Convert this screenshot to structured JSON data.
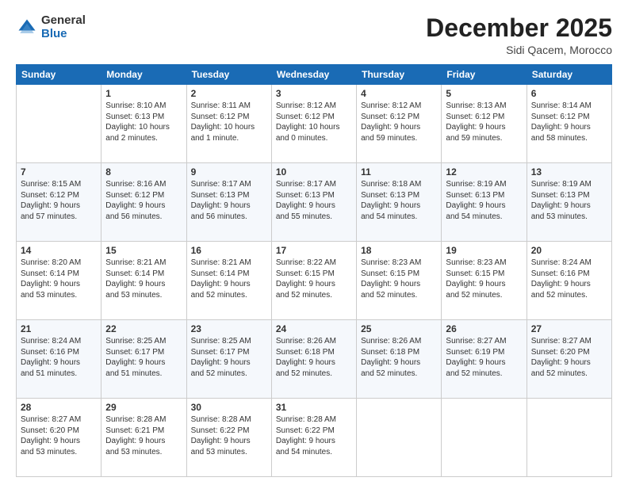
{
  "logo": {
    "general": "General",
    "blue": "Blue"
  },
  "title": "December 2025",
  "subtitle": "Sidi Qacem, Morocco",
  "weekdays": [
    "Sunday",
    "Monday",
    "Tuesday",
    "Wednesday",
    "Thursday",
    "Friday",
    "Saturday"
  ],
  "weeks": [
    [
      {
        "day": "",
        "content": ""
      },
      {
        "day": "1",
        "content": "Sunrise: 8:10 AM\nSunset: 6:13 PM\nDaylight: 10 hours\nand 2 minutes."
      },
      {
        "day": "2",
        "content": "Sunrise: 8:11 AM\nSunset: 6:12 PM\nDaylight: 10 hours\nand 1 minute."
      },
      {
        "day": "3",
        "content": "Sunrise: 8:12 AM\nSunset: 6:12 PM\nDaylight: 10 hours\nand 0 minutes."
      },
      {
        "day": "4",
        "content": "Sunrise: 8:12 AM\nSunset: 6:12 PM\nDaylight: 9 hours\nand 59 minutes."
      },
      {
        "day": "5",
        "content": "Sunrise: 8:13 AM\nSunset: 6:12 PM\nDaylight: 9 hours\nand 59 minutes."
      },
      {
        "day": "6",
        "content": "Sunrise: 8:14 AM\nSunset: 6:12 PM\nDaylight: 9 hours\nand 58 minutes."
      }
    ],
    [
      {
        "day": "7",
        "content": "Sunrise: 8:15 AM\nSunset: 6:12 PM\nDaylight: 9 hours\nand 57 minutes."
      },
      {
        "day": "8",
        "content": "Sunrise: 8:16 AM\nSunset: 6:12 PM\nDaylight: 9 hours\nand 56 minutes."
      },
      {
        "day": "9",
        "content": "Sunrise: 8:17 AM\nSunset: 6:13 PM\nDaylight: 9 hours\nand 56 minutes."
      },
      {
        "day": "10",
        "content": "Sunrise: 8:17 AM\nSunset: 6:13 PM\nDaylight: 9 hours\nand 55 minutes."
      },
      {
        "day": "11",
        "content": "Sunrise: 8:18 AM\nSunset: 6:13 PM\nDaylight: 9 hours\nand 54 minutes."
      },
      {
        "day": "12",
        "content": "Sunrise: 8:19 AM\nSunset: 6:13 PM\nDaylight: 9 hours\nand 54 minutes."
      },
      {
        "day": "13",
        "content": "Sunrise: 8:19 AM\nSunset: 6:13 PM\nDaylight: 9 hours\nand 53 minutes."
      }
    ],
    [
      {
        "day": "14",
        "content": "Sunrise: 8:20 AM\nSunset: 6:14 PM\nDaylight: 9 hours\nand 53 minutes."
      },
      {
        "day": "15",
        "content": "Sunrise: 8:21 AM\nSunset: 6:14 PM\nDaylight: 9 hours\nand 53 minutes."
      },
      {
        "day": "16",
        "content": "Sunrise: 8:21 AM\nSunset: 6:14 PM\nDaylight: 9 hours\nand 52 minutes."
      },
      {
        "day": "17",
        "content": "Sunrise: 8:22 AM\nSunset: 6:15 PM\nDaylight: 9 hours\nand 52 minutes."
      },
      {
        "day": "18",
        "content": "Sunrise: 8:23 AM\nSunset: 6:15 PM\nDaylight: 9 hours\nand 52 minutes."
      },
      {
        "day": "19",
        "content": "Sunrise: 8:23 AM\nSunset: 6:15 PM\nDaylight: 9 hours\nand 52 minutes."
      },
      {
        "day": "20",
        "content": "Sunrise: 8:24 AM\nSunset: 6:16 PM\nDaylight: 9 hours\nand 52 minutes."
      }
    ],
    [
      {
        "day": "21",
        "content": "Sunrise: 8:24 AM\nSunset: 6:16 PM\nDaylight: 9 hours\nand 51 minutes."
      },
      {
        "day": "22",
        "content": "Sunrise: 8:25 AM\nSunset: 6:17 PM\nDaylight: 9 hours\nand 51 minutes."
      },
      {
        "day": "23",
        "content": "Sunrise: 8:25 AM\nSunset: 6:17 PM\nDaylight: 9 hours\nand 52 minutes."
      },
      {
        "day": "24",
        "content": "Sunrise: 8:26 AM\nSunset: 6:18 PM\nDaylight: 9 hours\nand 52 minutes."
      },
      {
        "day": "25",
        "content": "Sunrise: 8:26 AM\nSunset: 6:18 PM\nDaylight: 9 hours\nand 52 minutes."
      },
      {
        "day": "26",
        "content": "Sunrise: 8:27 AM\nSunset: 6:19 PM\nDaylight: 9 hours\nand 52 minutes."
      },
      {
        "day": "27",
        "content": "Sunrise: 8:27 AM\nSunset: 6:20 PM\nDaylight: 9 hours\nand 52 minutes."
      }
    ],
    [
      {
        "day": "28",
        "content": "Sunrise: 8:27 AM\nSunset: 6:20 PM\nDaylight: 9 hours\nand 53 minutes."
      },
      {
        "day": "29",
        "content": "Sunrise: 8:28 AM\nSunset: 6:21 PM\nDaylight: 9 hours\nand 53 minutes."
      },
      {
        "day": "30",
        "content": "Sunrise: 8:28 AM\nSunset: 6:22 PM\nDaylight: 9 hours\nand 53 minutes."
      },
      {
        "day": "31",
        "content": "Sunrise: 8:28 AM\nSunset: 6:22 PM\nDaylight: 9 hours\nand 54 minutes."
      },
      {
        "day": "",
        "content": ""
      },
      {
        "day": "",
        "content": ""
      },
      {
        "day": "",
        "content": ""
      }
    ]
  ]
}
